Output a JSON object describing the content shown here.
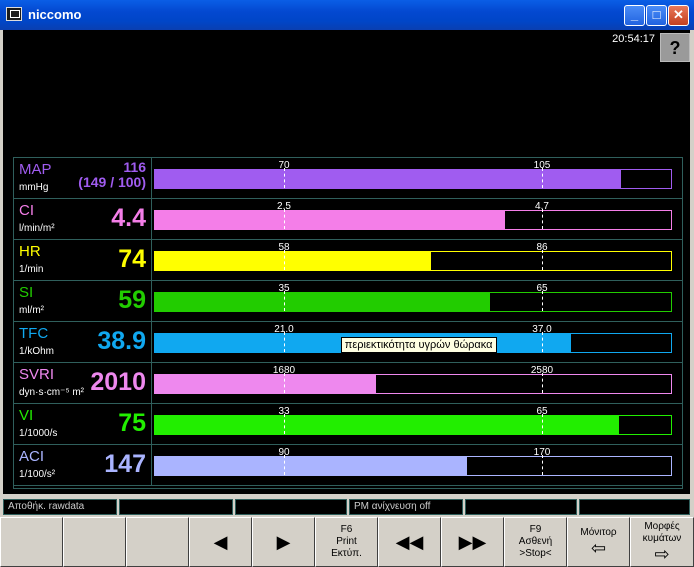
{
  "window": {
    "title": "niccomo"
  },
  "clock": "20:54:17",
  "help_label": "?",
  "parameters": [
    {
      "name": "MAP",
      "unit": "mmHg",
      "value": "116",
      "value2": "(149 / 100)",
      "color": "#a05cf0",
      "low": "70",
      "high": "105",
      "fill_fraction": 0.903,
      "low_fraction": 0.25,
      "high_fraction": 0.75
    },
    {
      "name": "CI",
      "unit": "l/min/m²",
      "value": "4.4",
      "color": "#f47ee8",
      "low": "2.5",
      "high": "4.7",
      "fill_fraction": 0.678,
      "low_fraction": 0.25,
      "high_fraction": 0.75
    },
    {
      "name": "HR",
      "unit": "1/min",
      "value": "74",
      "color": "#ffff00",
      "low": "58",
      "high": "86",
      "fill_fraction": 0.535,
      "low_fraction": 0.25,
      "high_fraction": 0.75
    },
    {
      "name": "SI",
      "unit": "ml/m²",
      "value": "59",
      "color": "#22cc00",
      "low": "35",
      "high": "65",
      "fill_fraction": 0.65,
      "low_fraction": 0.25,
      "high_fraction": 0.75
    },
    {
      "name": "TFC",
      "unit": "1/kOhm",
      "value": "38.9",
      "color": "#10a8f0",
      "low": "21.0",
      "high": "37.0",
      "fill_fraction": 0.807,
      "low_fraction": 0.25,
      "high_fraction": 0.75,
      "tooltip": "περιεκτικότητα υγρών θώρακα"
    },
    {
      "name": "SVRI",
      "unit": "dyn·s·cm⁻⁵ m²",
      "value": "2010",
      "color": "#ee88ee",
      "low": "1680",
      "high": "2580",
      "fill_fraction": 0.429,
      "low_fraction": 0.25,
      "high_fraction": 0.75
    },
    {
      "name": "VI",
      "unit": "1/1000/s",
      "value": "75",
      "color": "#22ee00",
      "low": "33",
      "high": "65",
      "fill_fraction": 0.9,
      "low_fraction": 0.25,
      "high_fraction": 0.75
    },
    {
      "name": "ACI",
      "unit": "1/100/s²",
      "value": "147",
      "color": "#aab4ff",
      "low": "90",
      "high": "170",
      "fill_fraction": 0.605,
      "low_fraction": 0.25,
      "high_fraction": 0.75
    }
  ],
  "status": {
    "rawdata": "Αποθήκ. rawdata",
    "pm": "PM ανίχνευση off"
  },
  "buttons": {
    "f6_key": "F6",
    "f6_l1": "Print",
    "f6_l2": "Εκτύπ.",
    "f9_key": "F9",
    "f9_l1": "Ασθενή",
    "f9_l2": ">Stop<",
    "monitor": "Μόνιτορ",
    "waveforms": "Μορφές κυμάτων"
  }
}
